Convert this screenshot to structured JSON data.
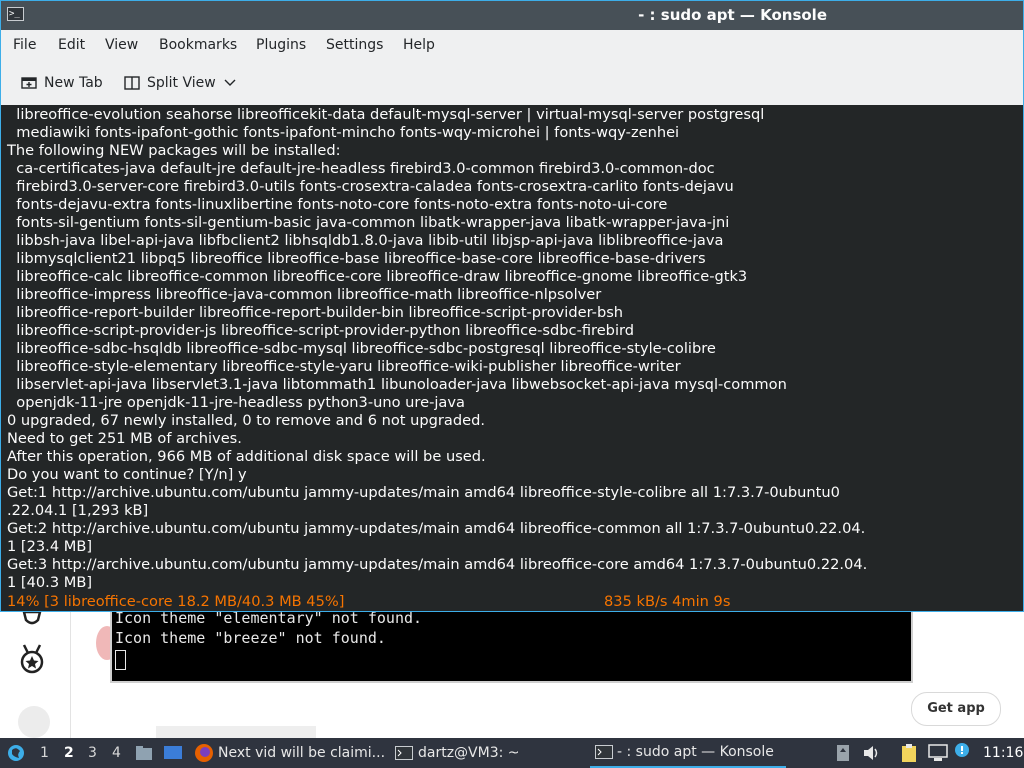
{
  "window": {
    "title": "- : sudo apt — Konsole"
  },
  "menu": [
    "File",
    "Edit",
    "View",
    "Bookmarks",
    "Plugins",
    "Settings",
    "Help"
  ],
  "toolbar": {
    "new_tab": "New Tab",
    "split_view": "Split View"
  },
  "terminal": {
    "lines": [
      "  libreoffice-evolution seahorse libreofficekit-data default-mysql-server | virtual-mysql-server postgresql",
      "  mediawiki fonts-ipafont-gothic fonts-ipafont-mincho fonts-wqy-microhei | fonts-wqy-zenhei",
      "The following NEW packages will be installed:",
      "  ca-certificates-java default-jre default-jre-headless firebird3.0-common firebird3.0-common-doc",
      "  firebird3.0-server-core firebird3.0-utils fonts-crosextra-caladea fonts-crosextra-carlito fonts-dejavu",
      "  fonts-dejavu-extra fonts-linuxlibertine fonts-noto-core fonts-noto-extra fonts-noto-ui-core",
      "  fonts-sil-gentium fonts-sil-gentium-basic java-common libatk-wrapper-java libatk-wrapper-java-jni",
      "  libbsh-java libel-api-java libfbclient2 libhsqldb1.8.0-java libib-util libjsp-api-java liblibreoffice-java",
      "  libmysqlclient21 libpq5 libreoffice libreoffice-base libreoffice-base-core libreoffice-base-drivers",
      "  libreoffice-calc libreoffice-common libreoffice-core libreoffice-draw libreoffice-gnome libreoffice-gtk3",
      "  libreoffice-impress libreoffice-java-common libreoffice-math libreoffice-nlpsolver",
      "  libreoffice-report-builder libreoffice-report-builder-bin libreoffice-script-provider-bsh",
      "  libreoffice-script-provider-js libreoffice-script-provider-python libreoffice-sdbc-firebird",
      "  libreoffice-sdbc-hsqldb libreoffice-sdbc-mysql libreoffice-sdbc-postgresql libreoffice-style-colibre",
      "  libreoffice-style-elementary libreoffice-style-yaru libreoffice-wiki-publisher libreoffice-writer",
      "  libservlet-api-java libservlet3.1-java libtommath1 libunoloader-java libwebsocket-api-java mysql-common",
      "  openjdk-11-jre openjdk-11-jre-headless python3-uno ure-java",
      "0 upgraded, 67 newly installed, 0 to remove and 6 not upgraded.",
      "Need to get 251 MB of archives.",
      "After this operation, 966 MB of additional disk space will be used.",
      "Do you want to continue? [Y/n] y",
      "Get:1 http://archive.ubuntu.com/ubuntu jammy-updates/main amd64 libreoffice-style-colibre all 1:7.3.7-0ubuntu0",
      ".22.04.1 [1,293 kB]",
      "Get:2 http://archive.ubuntu.com/ubuntu jammy-updates/main amd64 libreoffice-common all 1:7.3.7-0ubuntu0.22.04.",
      "1 [23.4 MB]",
      "Get:3 http://archive.ubuntu.com/ubuntu jammy-updates/main amd64 libreoffice-core amd64 1:7.3.7-0ubuntu0.22.04.",
      "1 [40.3 MB]"
    ],
    "progress_left": "14% [3 libreoffice-core 18.2 MB/40.3 MB 45%]",
    "progress_right": "835 kB/s 4min 9s",
    "progress_color": "#f67400"
  },
  "background": {
    "mini_terminal_lines": [
      "Icon theme \"elementary\" not found.",
      "Icon theme \"breeze\" not found."
    ],
    "get_app": "Get app"
  },
  "taskbar": {
    "workspaces": [
      "1",
      "2",
      "3",
      "4"
    ],
    "active_workspace": "2",
    "tasks": [
      "Next vid will be claimi...",
      "dartz@VM3: ~",
      "- : sudo apt — Konsole"
    ],
    "clock": "11:16"
  }
}
